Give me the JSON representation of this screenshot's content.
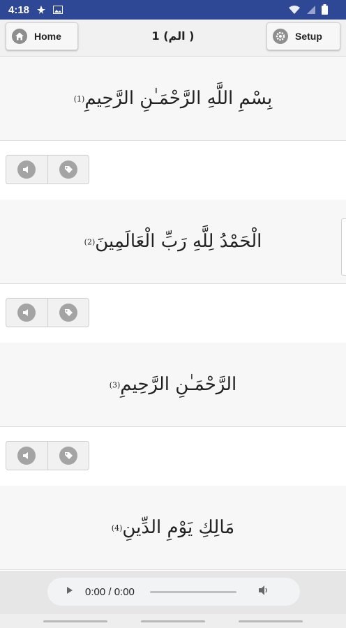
{
  "status_bar": {
    "time": "4:18"
  },
  "top_bar": {
    "home_label": "Home",
    "title": "1 (الم )",
    "setup_label": "Setup"
  },
  "verses": [
    {
      "text": "بِسْمِ اللَّهِ الرَّحْمَـٰنِ الرَّحِيمِ",
      "number": "(1)"
    },
    {
      "text": "الْحَمْدُ لِلَّهِ رَبِّ الْعَالَمِينَ",
      "number": "(2)"
    },
    {
      "text": "الرَّحْمَـٰنِ الرَّحِيمِ",
      "number": "(3)"
    },
    {
      "text": "مَالِكِ يَوْمِ الدِّينِ",
      "number": "(4)"
    }
  ],
  "audio_player": {
    "time": "0:00 / 0:00"
  },
  "icons": {
    "home": "home-icon",
    "setup": "gear-icon",
    "audio": "speaker-icon",
    "bookmark": "tag-icon"
  }
}
